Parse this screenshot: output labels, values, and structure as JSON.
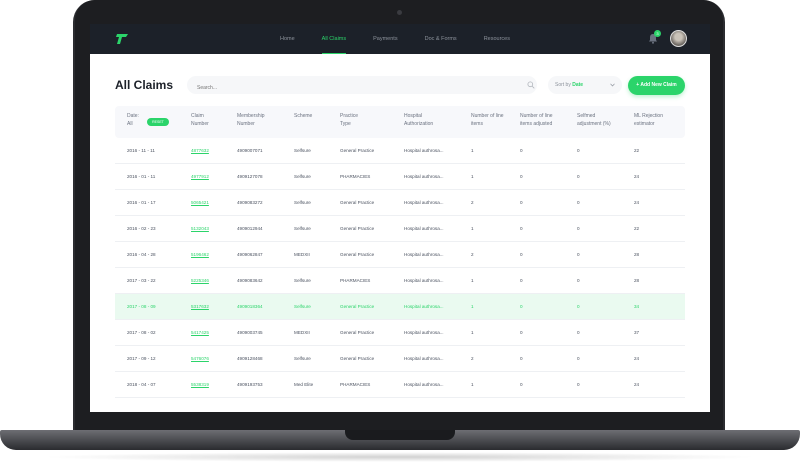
{
  "nav": {
    "items": [
      "Home",
      "All Claims",
      "Payments",
      "Doc & Forms",
      "Resources"
    ],
    "active_index": 1,
    "notification_count": "3"
  },
  "page": {
    "title": "All Claims",
    "search_placeholder": "Search...",
    "sort_prefix": "Sort by",
    "sort_value": "Date",
    "add_button": "+ Add New Claim"
  },
  "table": {
    "reset_label": "RESET",
    "headers": {
      "date_line1": "Date:",
      "date_line2": "All",
      "claim_line1": "Claim",
      "claim_line2": "Number",
      "membership_line1": "Membership",
      "membership_line2": "Number",
      "scheme": "Scheme",
      "practice_line1": "Practice",
      "practice_line2": "Type",
      "hospital_line1": "Hospital",
      "hospital_line2": "Authorization",
      "line_items_line1": "Number of line",
      "line_items_line2": "items",
      "adjusted_line1": "Number of line",
      "adjusted_line2": "items adjusted",
      "selfmed_line1": "Selfmed",
      "selfmed_line2": "adjustment (%)",
      "ml_line1": "ML Rejection",
      "ml_line2": "estimator"
    },
    "rows": [
      {
        "date": "2016 - 11 - 11",
        "claim": "4877632",
        "membership": "4909007071",
        "scheme": "Selfsure",
        "practice": "General Practice",
        "hospital": "Hospital authrosa...",
        "line_items": "1",
        "adjusted": "0",
        "selfmed": "0",
        "ml": "22",
        "highlight": false
      },
      {
        "date": "2016 - 01 - 11",
        "claim": "4977912",
        "membership": "4909127078",
        "scheme": "Selfsure",
        "practice": "PHARMACIES",
        "hospital": "Hospital authrosa...",
        "line_items": "1",
        "adjusted": "0",
        "selfmed": "0",
        "ml": "24",
        "highlight": false
      },
      {
        "date": "2016 - 01 - 17",
        "claim": "5065421",
        "membership": "4909083272",
        "scheme": "Selfsure",
        "practice": "General Practice",
        "hospital": "Hospital authrosa...",
        "line_items": "2",
        "adjusted": "0",
        "selfmed": "0",
        "ml": "24",
        "highlight": false
      },
      {
        "date": "2016 - 02 - 23",
        "claim": "5132043",
        "membership": "4909012944",
        "scheme": "Selfsure",
        "practice": "General Practice",
        "hospital": "Hospital authrosa...",
        "line_items": "1",
        "adjusted": "0",
        "selfmed": "0",
        "ml": "22",
        "highlight": false
      },
      {
        "date": "2016 - 04 - 28",
        "claim": "5196462",
        "membership": "4909062847",
        "scheme": "MEDXII",
        "practice": "General Practice",
        "hospital": "Hospital authrosa...",
        "line_items": "2",
        "adjusted": "0",
        "selfmed": "0",
        "ml": "28",
        "highlight": false
      },
      {
        "date": "2017 - 03 - 22",
        "claim": "5225346",
        "membership": "4909083642",
        "scheme": "Selfsure",
        "practice": "PHARMACIES",
        "hospital": "Hospital authrosa...",
        "line_items": "1",
        "adjusted": "0",
        "selfmed": "0",
        "ml": "28",
        "highlight": false
      },
      {
        "date": "2017 - 08 - 09",
        "claim": "5317632",
        "membership": "4909018364",
        "scheme": "Selfsure",
        "practice": "General Practice",
        "hospital": "Hospital authrosa...",
        "line_items": "1",
        "adjusted": "0",
        "selfmed": "0",
        "ml": "34",
        "highlight": true
      },
      {
        "date": "2017 - 08 - 02",
        "claim": "5417425",
        "membership": "4909003745",
        "scheme": "MEDXII",
        "practice": "General Practice",
        "hospital": "Hospital authrosa...",
        "line_items": "1",
        "adjusted": "0",
        "selfmed": "0",
        "ml": "37",
        "highlight": false
      },
      {
        "date": "2017 - 09 - 12",
        "claim": "5476076",
        "membership": "4909128468",
        "scheme": "Selfsure",
        "practice": "General Practice",
        "hospital": "Hospital authrosa...",
        "line_items": "2",
        "adjusted": "0",
        "selfmed": "0",
        "ml": "24",
        "highlight": false
      },
      {
        "date": "2018 - 04 - 07",
        "claim": "5538319",
        "membership": "4909193753",
        "scheme": "Med Elite",
        "practice": "PHARMACIES",
        "hospital": "Hospital authrosa...",
        "line_items": "1",
        "adjusted": "0",
        "selfmed": "0",
        "ml": "24",
        "highlight": false
      }
    ]
  },
  "colors": {
    "accent": "#2bd46a",
    "nav_bg": "#1c2129",
    "highlight_row": "#eafaf0"
  }
}
